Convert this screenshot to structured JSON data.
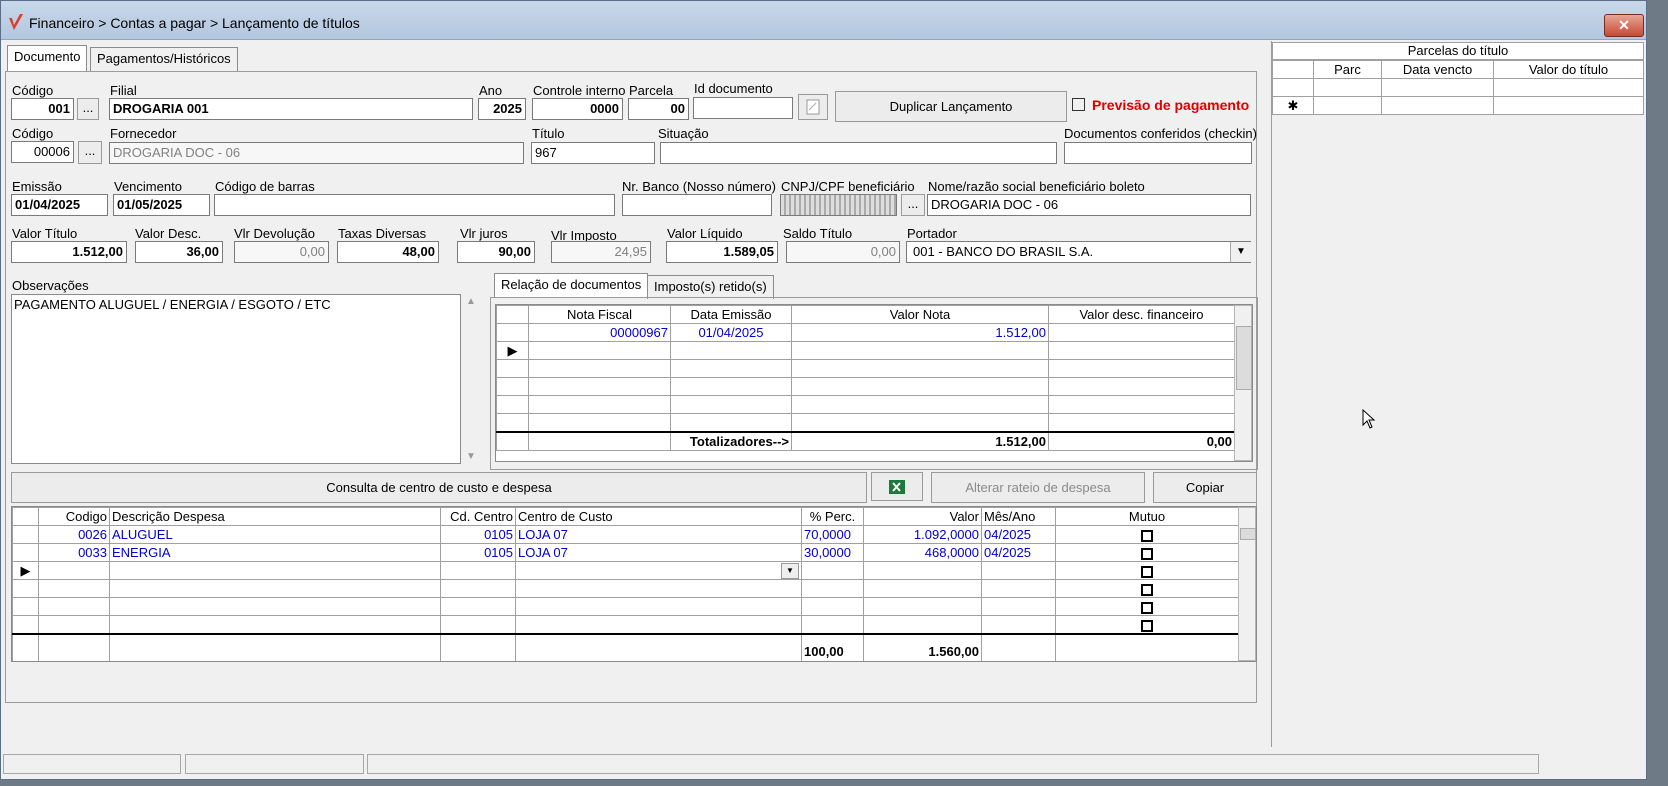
{
  "window": {
    "title": "Financeiro > Contas a pagar > Lançamento de títulos",
    "close_label": "✕"
  },
  "tabs": [
    {
      "label": "Documento"
    },
    {
      "label": "Pagamentos/Históricos"
    }
  ],
  "form": {
    "codigo_label": "Código",
    "codigo_value": "001",
    "filial_label": "Filial",
    "filial_value": "DROGARIA 001",
    "ano_label": "Ano",
    "ano_value": "2025",
    "controle_label": "Controle interno",
    "controle_value": "0000",
    "parcela_label": "Parcela",
    "parcela_value": "00",
    "iddoc_label": "Id documento",
    "iddoc_value": "",
    "duplicar_label": "Duplicar Lançamento",
    "previsao_label": "Previsão de pagamento",
    "codigo2_label": "Código",
    "codigo2_value": "00006",
    "fornecedor_label": "Fornecedor",
    "fornecedor_value": "DROGARIA DOC - 06",
    "titulo_label": "Título",
    "titulo_value": "967",
    "situacao_label": "Situação",
    "situacao_value": "",
    "checkin_label": "Documentos conferidos (checkin)",
    "checkin_value": "",
    "emissao_label": "Emissão",
    "emissao_value": "01/04/2025",
    "venc_label": "Vencimento",
    "venc_value": "01/05/2025",
    "barras_label": "Código de barras",
    "barras_value": "",
    "nrbanco_label": "Nr. Banco (Nosso número)",
    "nrbanco_value": "",
    "cnpj_label": "CNPJ/CPF beneficiário",
    "cnpj_value": "",
    "nome_benef_label": "Nome/razão social beneficiário boleto",
    "nome_benef_value": "DROGARIA DOC - 06",
    "valor_titulo_label": "Valor Título",
    "valor_titulo_value": "1.512,00",
    "valor_desc_label": "Valor Desc.",
    "valor_desc_value": "36,00",
    "vlr_dev_label": "Vlr Devolução",
    "vlr_dev_value": "0,00",
    "taxas_label": "Taxas Diversas",
    "taxas_value": "48,00",
    "juros_label": "Vlr juros",
    "juros_value": "90,00",
    "imposto_label": "Vlr Imposto",
    "imposto_value": "24,95",
    "liquido_label": "Valor Líquido",
    "liquido_value": "1.589,05",
    "saldo_label": "Saldo Título",
    "saldo_value": "0,00",
    "portador_label": "Portador",
    "portador_value": "001 - BANCO DO BRASIL S.A.",
    "obs_label": "Observações",
    "obs_value": "PAGAMENTO ALUGUEL / ENERGIA / ESGOTO / ETC",
    "ellipsis": "..."
  },
  "doc_tabs": [
    {
      "label": "Relação de documentos"
    },
    {
      "label": "Imposto(s) retido(s)"
    }
  ],
  "docs_grid": {
    "headers": [
      "Nota Fiscal",
      "Data Emissão",
      "Valor Nota",
      "Valor desc. financeiro"
    ],
    "rows": [
      [
        "00000967",
        "01/04/2025",
        "1.512,00",
        ""
      ]
    ],
    "totals_label": "Totalizadores-->",
    "total_valor": "1.512,00",
    "total_desc": "0,00"
  },
  "cost_buttons": {
    "consulta": "Consulta de centro de custo e despesa",
    "alterar": "Alterar rateio de despesa",
    "copiar": "Copiar"
  },
  "cost_grid": {
    "headers": [
      "Codigo",
      "Descrição Despesa",
      "Cd. Centro",
      "Centro de Custo",
      "% Perc.",
      "Valor",
      "Mês/Ano",
      "Mutuo"
    ],
    "rows": [
      [
        "0026",
        "ALUGUEL",
        "0105",
        "LOJA 07",
        "70,0000",
        "1.092,0000",
        "04/2025"
      ],
      [
        "0033",
        "ENERGIA",
        "0105",
        "LOJA 07",
        "30,0000",
        "468,0000",
        "04/2025"
      ]
    ],
    "total_perc": "100,00",
    "total_valor": "1.560,00"
  },
  "parcelas": {
    "title": "Parcelas do título",
    "headers": [
      "Parc",
      "Data vencto",
      "Valor do título"
    ],
    "new_row_marker": "✱"
  }
}
